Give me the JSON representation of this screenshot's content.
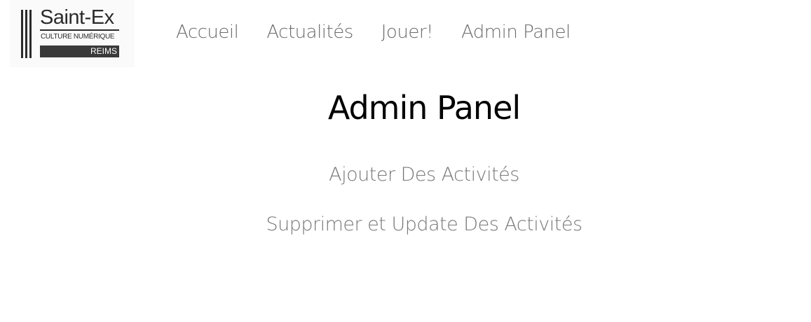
{
  "logo": {
    "title": "Saint-Ex",
    "subtitle": "CULTURE NUMÉRIQUE",
    "city": "REIMS"
  },
  "nav": {
    "items": [
      {
        "label": "Accueil"
      },
      {
        "label": "Actualités"
      },
      {
        "label": "Jouer!"
      },
      {
        "label": "Admin Panel"
      }
    ]
  },
  "main": {
    "title": "Admin Panel",
    "actions": [
      {
        "label": "Ajouter Des Activités"
      },
      {
        "label": "Supprimer et Update Des Activités"
      }
    ]
  }
}
